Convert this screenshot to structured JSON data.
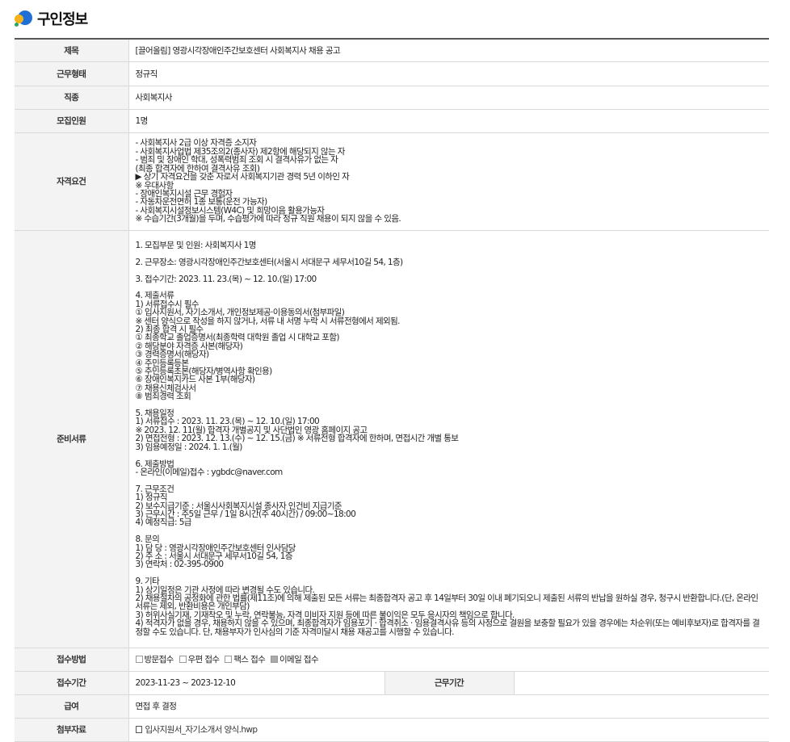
{
  "page": {
    "title": "구인정보"
  },
  "rows": {
    "title": {
      "label": "제목",
      "value": "[끌어올림] 영광시각장애인주간보호센터 사회복지사 채용 공고"
    },
    "employment_type": {
      "label": "근무형태",
      "value": "정규직"
    },
    "job_category": {
      "label": "직종",
      "value": "사회복지사"
    },
    "headcount": {
      "label": "모집인원",
      "value": "1명"
    },
    "qualifications": {
      "label": "자격요건",
      "value": "- 사회복지사 2급 이상 자격증 소지자\n- 사회복지사업법 제35조의2(종사자) 제2항에 해당되지 않는 자\n- 범죄 및 장애인 학대, 성폭력범죄 조회 시 결격사유가 없는 자\n(최종 합격자에 한하여 결격사유 조회)\n▶ 상기 자격요건을 갖춘 자로서 사회복지기관 경력 5년 이하인 자\n※ 우대사항\n- 장애인복지시설 근무 경험자\n- 자동차운전면허 1종 보통(운전 가능자)\n- 사회복지시설정보시스템(W4C) 및 희망이음 활용가능자\n※ 수습기간(3개월)을 두며, 수습평가에 따라 정규 직원 채용이 되지 않을 수 있음."
    },
    "documents": {
      "label": "준비서류",
      "value": "1. 모집부문 및 인원: 사회복지사 1명\n\n2. 근무장소: 영광시각장애인주간보호센터(서울시 서대문구 세무서10길 54, 1층)\n\n3. 접수기간: 2023. 11. 23.(목) ~ 12. 10.(일) 17:00\n\n4. 제출서류\n1) 서류접수시 필수\n① 입사지원서, 자기소개서, 개인정보제공·이용동의서(첨부파일)\n※ 센터 양식으로 작성을 하지 않거나, 서류 내 서명 누락 시 서류전형에서 제외됨.\n2) 최종 합격 시 필수\n① 최종학교 졸업증명서(최종학력 대학원 졸업 시 대학교 포함)\n② 해당분야 자격증 사본(해당자)\n③ 경력증명서(해당자)\n④ 주민등록등본\n⑤ 주민등록초본(해당자/병역사항 확인용)\n⑥ 장애인복지카드 사본 1부(해당자)\n⑦ 채용신체검사서\n⑧ 범죄경력 조회\n\n5. 채용일정\n1) 서류접수 : 2023. 11. 23.(목) ~ 12. 10.(일) 17:00\n※ 2023. 12. 11(월) 합격자 개별공지 및 사단법인 영광 홈페이지 공고\n2) 면접전형 : 2023. 12. 13.(수) ~ 12. 15.(금) ※ 서류전형 합격자에 한하며, 면접시간 개별 통보\n3) 임용예정일 : 2024. 1. 1.(월)\n\n6. 제출방법\n- 온라인(이메일)접수 : ygbdc@naver.com\n\n7. 근무조건\n1) 정규직\n2) 보수지급기준 : 서울시사회복지시설 종사자 인건비 지급기준\n3) 근무시간 : 주5일 근무 / 1일 8시간(주 40시간) / 09:00~18:00\n4) 예정직급: 5급\n\n8. 문의\n1) 담 당 : 영광시각장애인주간보호센터 인사담당\n2) 주 소 : 서울시 서대문구 세무서10길 54, 1층\n3) 연락처 : 02-395-0900\n\n9. 기타\n1) 상기일정은 기관 사정에 따라 변경될 수도 있습니다.\n2) 채용절차의 공정화에 관한 법률(제11조)에 의해 제출된 모든 서류는 최종합격자 공고 후 14일부터 30일 이내 폐기되오니 제출된 서류의 반납을 원하실 경우, 청구시 반환합니다.(단, 온라인 서류는 제외, 반환비용은 개인부담)\n3) 허위사실기재, 기재착오 및 누락, 연락불능, 자격 미비자 지원 등에 따른 불이익은 모두 응시자의 책임으로 합니다.\n4) 적격자가 없을 경우, 채용하지 않을 수 있으며, 최종합격자가 임용포기 · 합격취소 · 임용결격사유 등의 사정으로 결원을 보충할 필요가 있을 경우에는 차순위(또는 예비후보자)로 합격자를 결정할 수도 있습니다. 단, 채용부자가 인사심의 기준 자격미달시 채용 재공고를 시행할 수 있습니다."
    },
    "application_method": {
      "label": "접수방법",
      "options": [
        {
          "label": "방문접수",
          "checked": false
        },
        {
          "label": "우편 접수",
          "checked": false
        },
        {
          "label": "팩스 접수",
          "checked": false
        },
        {
          "label": "이메일 접수",
          "checked": true
        }
      ]
    },
    "application_period": {
      "label": "접수기간",
      "value": "2023-11-23 ~ 2023-12-10",
      "work_period_label": "근무기간",
      "work_period_value": ""
    },
    "salary": {
      "label": "급여",
      "value": "면접 후 결정"
    },
    "attachment": {
      "label": "첨부자료",
      "value": "입사지원서_자기소개서 양식.hwp"
    }
  },
  "colors": {
    "header_bg": "#f3f3f3",
    "border": "#d9d9d9",
    "top_border": "#555555"
  }
}
